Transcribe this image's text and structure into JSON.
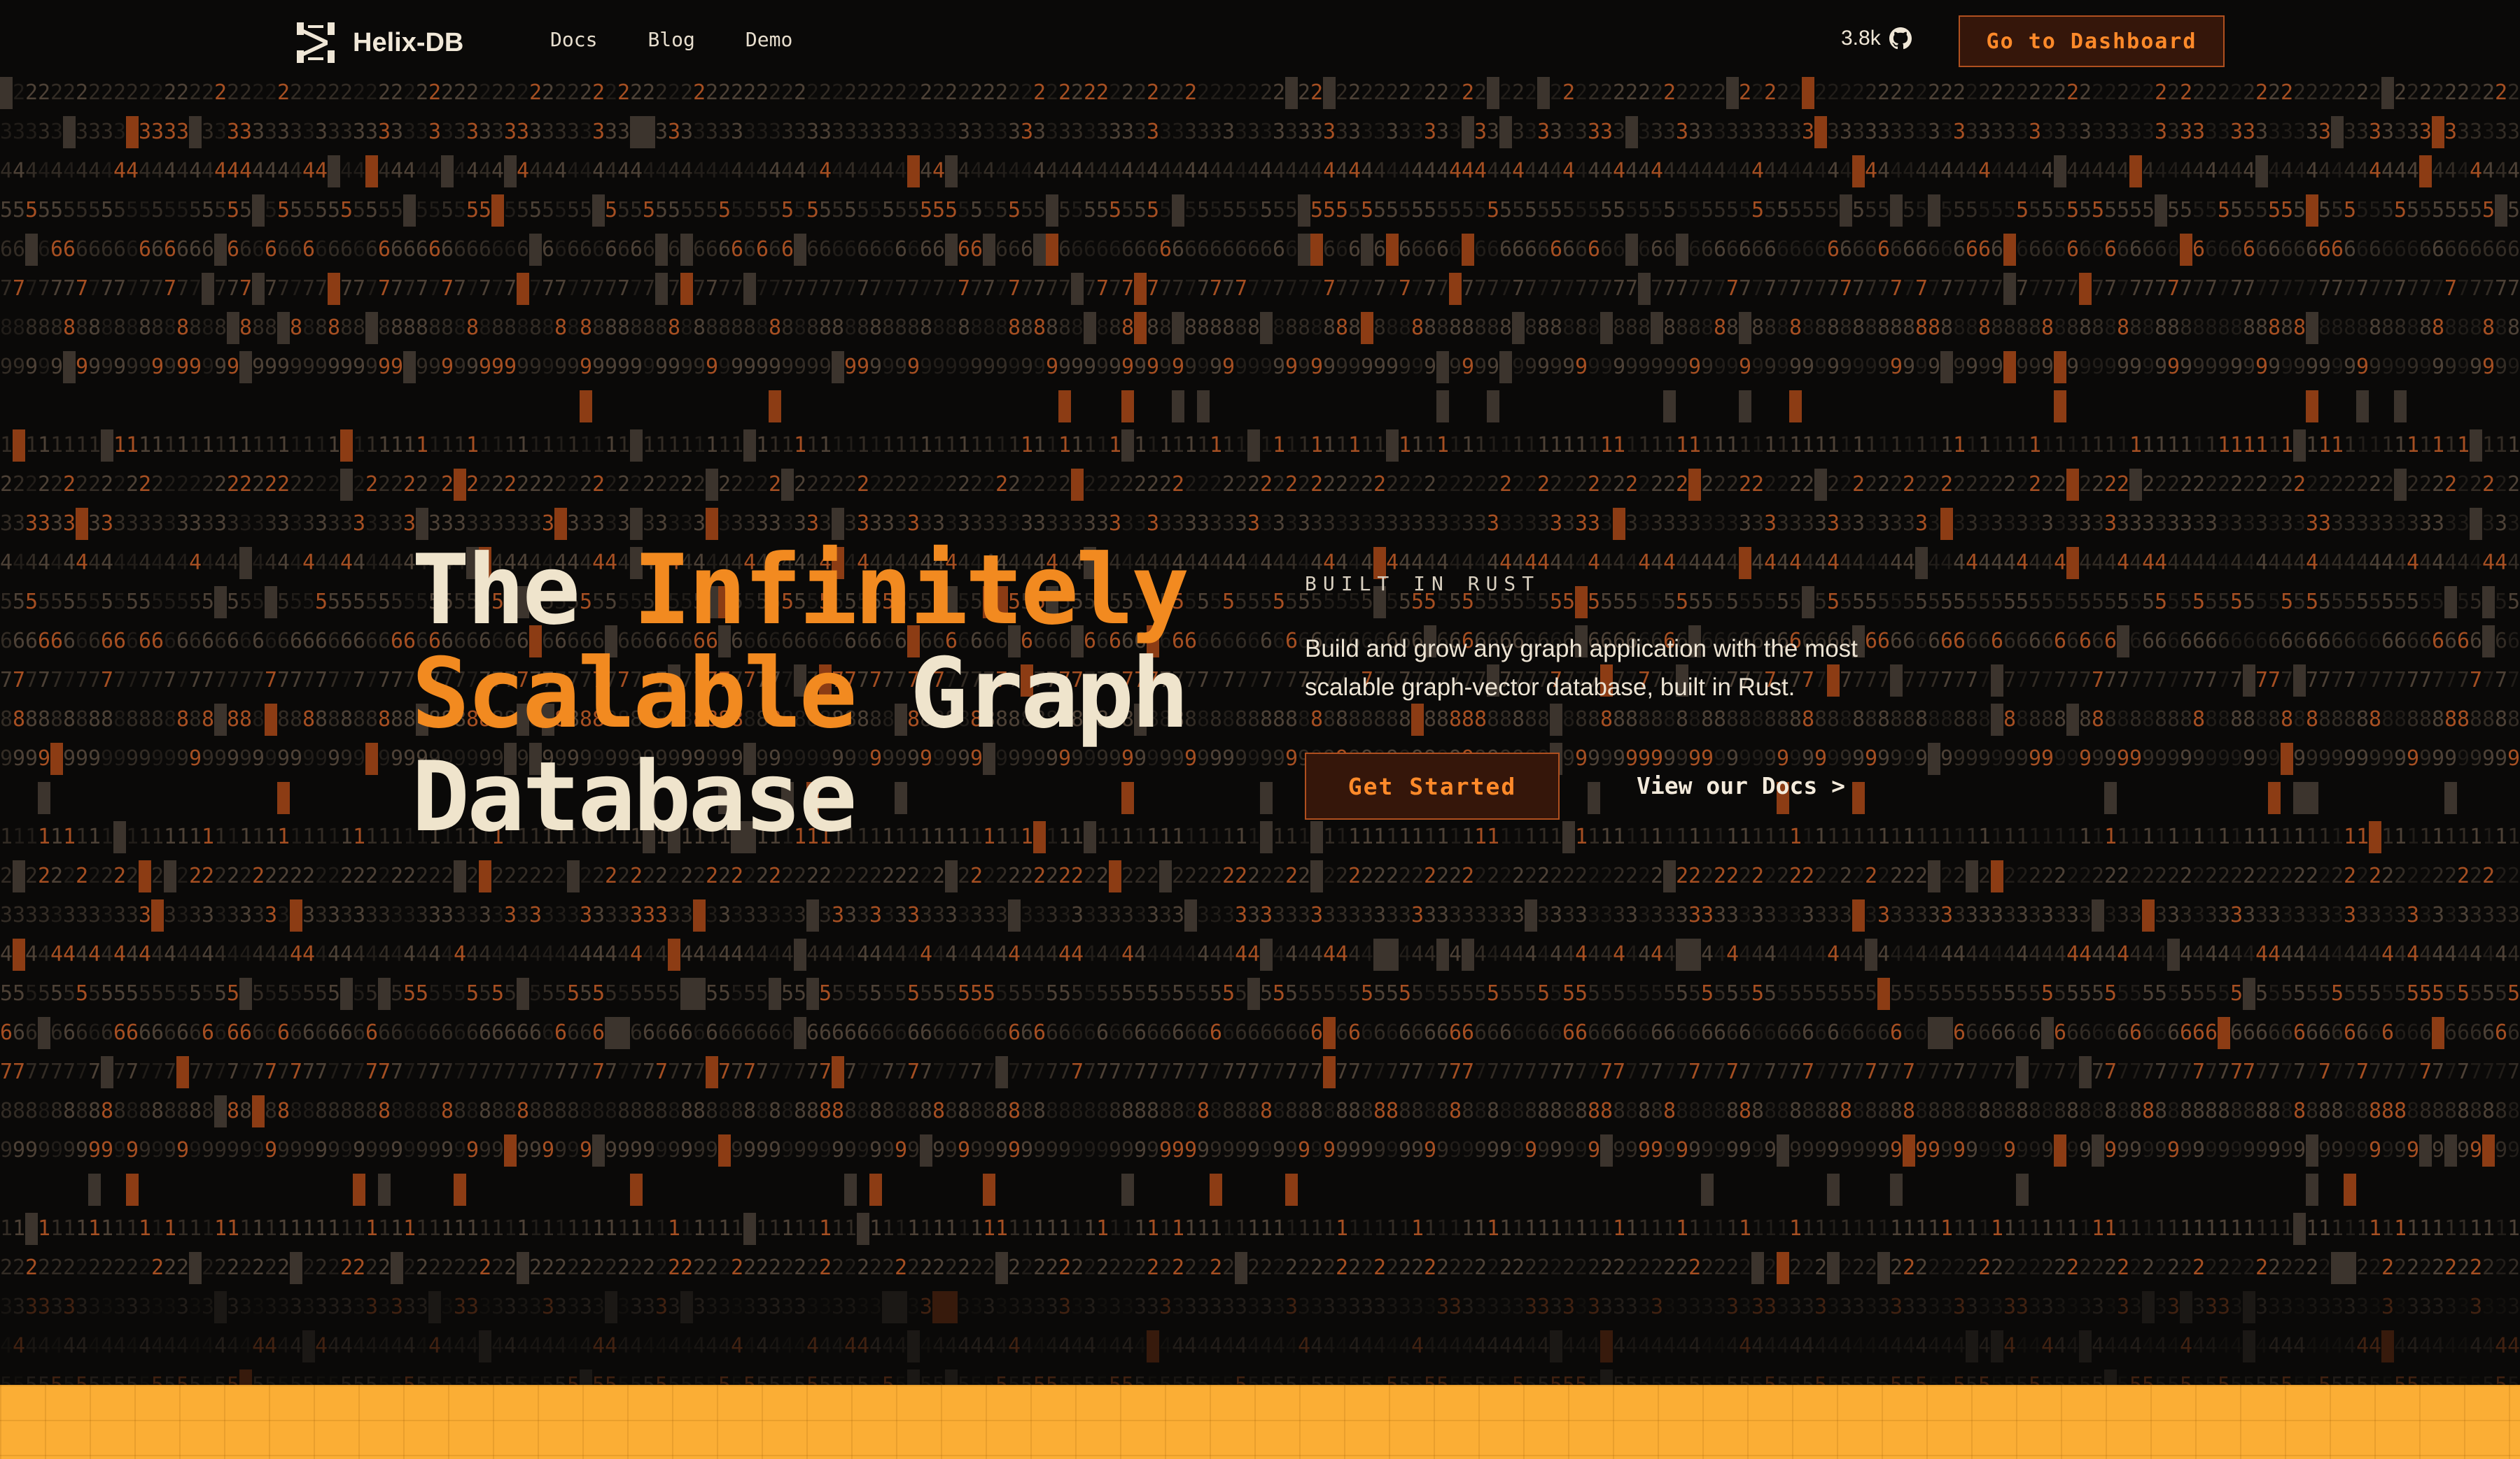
{
  "nav": {
    "brand": "Helix-DB",
    "logo_icon": "helix-logo-icon",
    "links": [
      "Docs",
      "Blog",
      "Demo"
    ],
    "stars": "3.8k",
    "stars_icon": "github-icon",
    "dashboard_label": "Go to Dashboard"
  },
  "hero": {
    "title_line1_plain": "The",
    "title_line1_accent": "Infinitely",
    "title_line2_accent": "Scalable",
    "title_line2_plain": "Graph",
    "title_line3_plain": "Database",
    "eyebrow": "BUILT IN RUST",
    "description_line1": "Build and grow any graph application with the most",
    "description_line2": "scalable graph-vector database, built in Rust.",
    "cta_label": "Get Started",
    "docs_label": "View our Docs >"
  },
  "colors": {
    "background": "#0a0908",
    "accent": "#f28a20",
    "button_bg": "#35160a",
    "button_border": "#b0501f",
    "footer_band": "#fbae35"
  }
}
